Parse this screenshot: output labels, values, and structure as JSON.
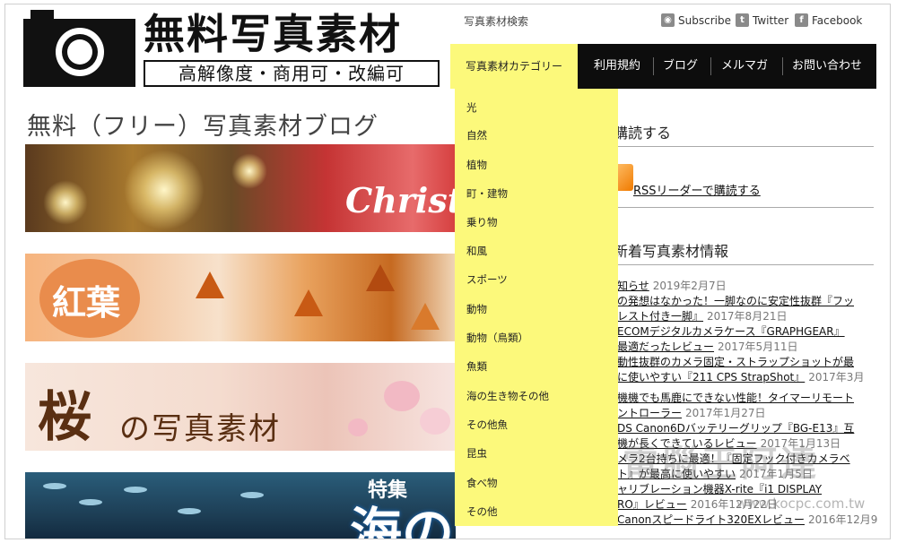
{
  "logo": {
    "title": "無料写真素材",
    "subtitle": "高解像度・商用可・改編可"
  },
  "header": {
    "search_link": "写真素材検索",
    "social": {
      "subscribe": "Subscribe",
      "twitter": "Twitter",
      "facebook": "Facebook"
    }
  },
  "nav": {
    "active": "写真素材カテゴリー",
    "items": [
      "利用規約",
      "ブログ",
      "メルマガ",
      "お問い合わせ"
    ]
  },
  "dropdown": {
    "items": [
      "光",
      "自然",
      "植物",
      "町・建物",
      "乗り物",
      "和風",
      "スポーツ",
      "動物",
      "動物（鳥類）",
      "魚類",
      "海の生き物その他",
      "その他魚",
      "昆虫",
      "食べ物",
      "その他"
    ]
  },
  "blog": {
    "title": "無料（フリー）写真素材ブログ"
  },
  "banners": {
    "christmas": "Christmas",
    "koyo": "紅葉",
    "sakura": "桜",
    "sakura_rest": "の写真素材",
    "umi": "海の生き物",
    "umi_top": "特集"
  },
  "sidebar": {
    "subscribe_heading": "購読する",
    "rss_link": "RSSリーダーで購読する",
    "news_heading": "新着写真素材情報",
    "news": [
      {
        "title": "知らせ",
        "date": "2019年2月7日"
      },
      {
        "title": "の発想はなかった！一脚なのに安定性抜群『フッ",
        "date": ""
      },
      {
        "title": "レスト付き一脚』",
        "date": "2017年8月21日"
      },
      {
        "title": "ECOMデジタルカメラケース『GRAPHGEAR』",
        "date": ""
      },
      {
        "title": "最適だったレビュー",
        "date": "2017年5月11日"
      },
      {
        "title": "動性抜群のカメラ固定・ストラップショットが最",
        "date": ""
      },
      {
        "title": "に使いやすい『211 CPS StrapShot』",
        "date": "2017年3月"
      },
      {
        "title": "",
        "date": ""
      },
      {
        "title": "機機でも馬鹿にできない性能！タイマーリモート",
        "date": ""
      },
      {
        "title": "ントローラー",
        "date": "2017年1月27日"
      },
      {
        "title": "DS Canon6Dバッテリーグリップ『BG-E13』互",
        "date": ""
      },
      {
        "title": "機が長くできているレビュー",
        "date": "2017年1月13日"
      },
      {
        "title": "メラ2台持ちに最適！『固定フック付きカメラベ",
        "date": ""
      },
      {
        "title": "ト』が最高に使いやすい",
        "date": "2017年1月5日"
      },
      {
        "title": "ャリブレーション機器X-rite『i1 DISPLAY",
        "date": ""
      },
      {
        "title": "RO』レビュー",
        "date": "2016年12月22日"
      },
      {
        "title": "Canonスピードライト320EXレビュー",
        "date": "2016年12月9"
      }
    ]
  },
  "watermark": {
    "text": "電腦王阿達",
    "url": "www.kocpc.com.tw"
  },
  "colors": {
    "nav_bg": "#0d0d0d",
    "dropdown_bg": "#fcf97b",
    "rss": "#f07a00"
  }
}
